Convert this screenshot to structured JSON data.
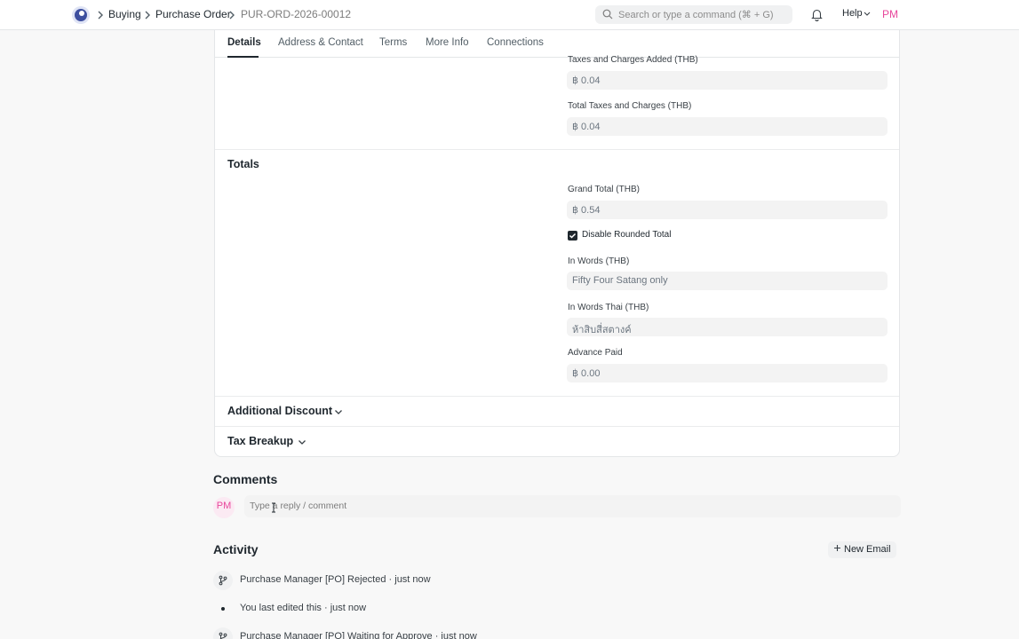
{
  "breadcrumbs": [
    "Buying",
    "Purchase Order",
    "PUR-ORD-2026-00012"
  ],
  "search": {
    "placeholder": "Search or type a command (⌘ + G)"
  },
  "help_label": "Help",
  "user_initials": "PM",
  "tabs": [
    "Details",
    "Address & Contact",
    "Terms",
    "More Info",
    "Connections"
  ],
  "active_tab": "Details",
  "taxes": {
    "added_label": "Taxes and Charges Added (THB)",
    "added_value": "฿ 0.04",
    "total_label": "Total Taxes and Charges (THB)",
    "total_value": "฿ 0.04"
  },
  "totals": {
    "title": "Totals",
    "grand_total_label": "Grand Total (THB)",
    "grand_total_value": "฿ 0.54",
    "disable_rounded_label": "Disable Rounded Total",
    "disable_rounded_checked": true,
    "in_words_label": "In Words (THB)",
    "in_words_value": "Fifty Four Satang only",
    "in_words_thai_label": "In Words Thai (THB)",
    "in_words_thai_value": "ห้าสิบสี่สตางค์",
    "advance_paid_label": "Advance Paid",
    "advance_paid_value": "฿ 0.00"
  },
  "sections": {
    "additional_discount": "Additional Discount",
    "tax_breakup": "Tax Breakup"
  },
  "comments": {
    "title": "Comments",
    "placeholder": "Type a reply / comment"
  },
  "activity": {
    "title": "Activity",
    "new_email_label": "New Email",
    "items": [
      {
        "text": "Purchase Manager [PO] Rejected · just now"
      },
      {
        "text": "You last edited this · just now"
      },
      {
        "text": "Purchase Manager [PO] Waiting for Approve · just now"
      }
    ]
  },
  "colors": {
    "accent_pink": "#e8479c",
    "text": "#1f272e",
    "field_bg": "#f3f3f3"
  }
}
